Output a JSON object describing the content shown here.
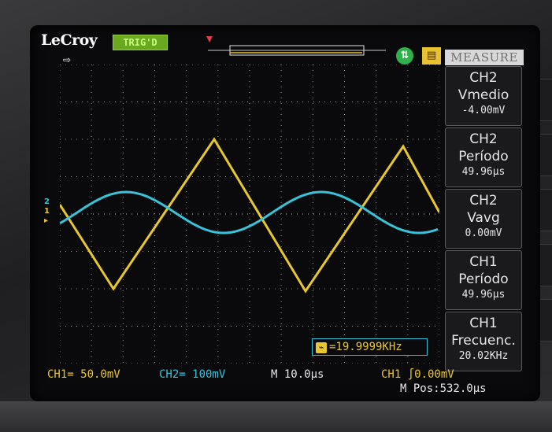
{
  "brand": "LeCroy",
  "run_status": "TRIG'D",
  "menu_title": "MEASURE",
  "markers": {
    "ch2": "2",
    "ch1": "1"
  },
  "measurements": [
    {
      "channel": "CH2",
      "name": "Vmedio",
      "value": "-4.00mV"
    },
    {
      "channel": "CH2",
      "name": "Período",
      "value": "49.96µs"
    },
    {
      "channel": "CH2",
      "name": "Vavg",
      "value": "0.00mV"
    },
    {
      "channel": "CH1",
      "name": "Período",
      "value": "49.96µs"
    },
    {
      "channel": "CH1",
      "name": "Frecuenc.",
      "value": "20.02KHz"
    }
  ],
  "freq_readout": "=19.9999KHz",
  "status": {
    "ch1_scale": "CH1= 50.0mV",
    "ch2_scale": "CH2= 100mV",
    "timebase": "M 10.0µs",
    "trigger": "CH1 ∫0.00mV",
    "mpos": "M Pos:532.0µs"
  },
  "colors": {
    "ch1": "#e8c630",
    "ch2": "#39c2d8",
    "grid": "#8a8a8a"
  }
}
